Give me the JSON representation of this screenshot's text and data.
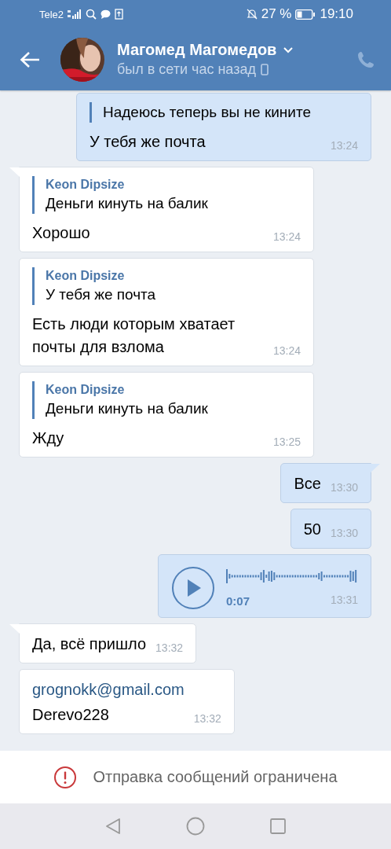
{
  "status_bar": {
    "carrier": "Tele2",
    "battery": "27 %",
    "time": "19:10"
  },
  "header": {
    "name": "Магомед Магомедов",
    "status": "был в сети час назад"
  },
  "messages": [
    {
      "kind": "text",
      "outgoing": true,
      "tail": false,
      "quote": {
        "text": "Надеюсь теперь вы не кините"
      },
      "text": "У тебя же почта",
      "time": "13:24"
    },
    {
      "kind": "text",
      "outgoing": false,
      "tail": true,
      "quote": {
        "author": "Keon Dipsize",
        "text": "Деньги кинуть на балик"
      },
      "text": "Хорошо",
      "time": "13:24"
    },
    {
      "kind": "text",
      "outgoing": false,
      "tail": false,
      "quote": {
        "author": "Keon Dipsize",
        "text": "У тебя же почта"
      },
      "text": "Есть люди которым хватает почты для взлома",
      "time": "13:24"
    },
    {
      "kind": "text",
      "outgoing": false,
      "tail": false,
      "quote": {
        "author": "Keon Dipsize",
        "text": "Деньги кинуть на балик"
      },
      "text": "Жду",
      "time": "13:25"
    },
    {
      "kind": "text",
      "outgoing": true,
      "tail": true,
      "text": "Все",
      "time": "13:30"
    },
    {
      "kind": "text",
      "outgoing": true,
      "tail": false,
      "text": "50",
      "time": "13:30"
    },
    {
      "kind": "voice",
      "outgoing": true,
      "tail": false,
      "duration": "0:07",
      "time": "13:31"
    },
    {
      "kind": "text",
      "outgoing": false,
      "tail": true,
      "text": "Да, всё пришло",
      "time": "13:32"
    },
    {
      "kind": "text",
      "outgoing": false,
      "tail": false,
      "link": "grognokk@gmail.com",
      "text": "Derevo228",
      "time": "13:32"
    }
  ],
  "restriction": {
    "text": "Отправка сообщений ограничена"
  }
}
